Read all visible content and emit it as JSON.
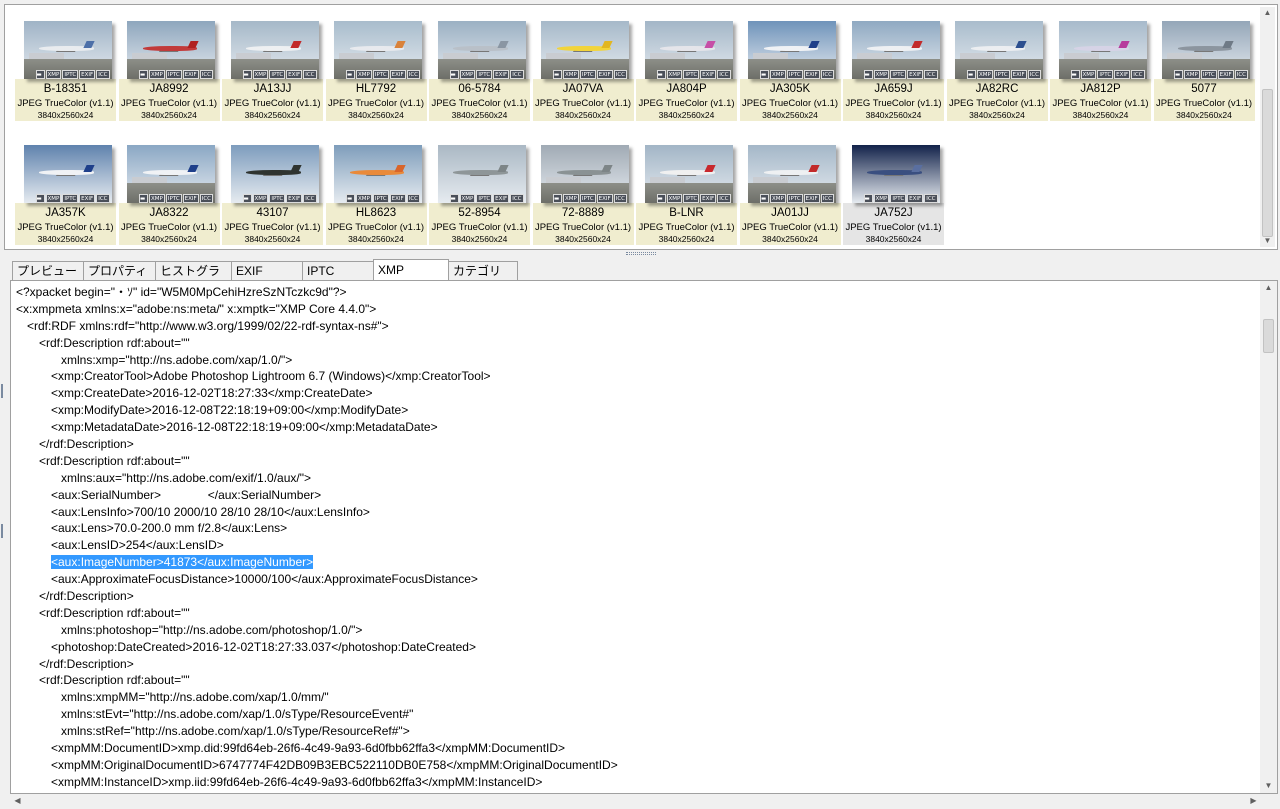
{
  "thumbnails": [
    {
      "name": "B-18351",
      "format": "JPEG TrueColor (v1.1)",
      "dims": "3840x2560x24",
      "sky": "#9fb3c6",
      "body": "#e9ecef",
      "tail": "#4c6fa8",
      "ground": true,
      "selected": false
    },
    {
      "name": "JA8992",
      "format": "JPEG TrueColor (v1.1)",
      "dims": "3840x2560x24",
      "sky": "#8ea6bd",
      "body": "#c23a3a",
      "tail": "#b02020",
      "ground": true,
      "selected": false
    },
    {
      "name": "JA13JJ",
      "format": "JPEG TrueColor (v1.1)",
      "dims": "3840x2560x24",
      "sky": "#a5b8c8",
      "body": "#eef0f2",
      "tail": "#c22a2a",
      "ground": true,
      "selected": false
    },
    {
      "name": "HL7792",
      "format": "JPEG TrueColor (v1.1)",
      "dims": "3840x2560x24",
      "sky": "#a8bccc",
      "body": "#e8eaee",
      "tail": "#d9823a",
      "ground": true,
      "selected": false
    },
    {
      "name": "06-5784",
      "format": "JPEG TrueColor (v1.1)",
      "dims": "3840x2560x24",
      "sky": "#9bb0c3",
      "body": "#b9c0c8",
      "tail": "#8a96a3",
      "ground": true,
      "selected": false
    },
    {
      "name": "JA07VA",
      "format": "JPEG TrueColor (v1.1)",
      "dims": "3840x2560x24",
      "sky": "#a6b9c9",
      "body": "#f2d43a",
      "tail": "#e2b620",
      "ground": true,
      "selected": false
    },
    {
      "name": "JA804P",
      "format": "JPEG TrueColor (v1.1)",
      "dims": "3840x2560x24",
      "sky": "#a3b6c7",
      "body": "#e5e5ea",
      "tail": "#c64fa6",
      "ground": true,
      "selected": false
    },
    {
      "name": "JA305K",
      "format": "JPEG TrueColor (v1.1)",
      "dims": "3840x2560x24",
      "sky": "#6f93ba",
      "body": "#f0f2f5",
      "tail": "#1e3f8a",
      "ground": true,
      "selected": false
    },
    {
      "name": "JA659J",
      "format": "JPEG TrueColor (v1.1)",
      "dims": "3840x2560x24",
      "sky": "#8fa9c2",
      "body": "#eef0f3",
      "tail": "#c22a2a",
      "ground": true,
      "selected": false
    },
    {
      "name": "JA82RC",
      "format": "JPEG TrueColor (v1.1)",
      "dims": "3840x2560x24",
      "sky": "#a9bccc",
      "body": "#eceef1",
      "tail": "#2c4f8f",
      "ground": true,
      "selected": false
    },
    {
      "name": "JA812P",
      "format": "JPEG TrueColor (v1.1)",
      "dims": "3840x2560x24",
      "sky": "#a7bacb",
      "body": "#d6d3e6",
      "tail": "#b73a9c",
      "ground": true,
      "selected": false
    },
    {
      "name": "5077",
      "format": "JPEG TrueColor (v1.1)",
      "dims": "3840x2560x24",
      "sky": "#94a6b8",
      "body": "#8c959f",
      "tail": "#6f7a86",
      "ground": true,
      "selected": false
    },
    {
      "name": "JA357K",
      "format": "JPEG TrueColor (v1.1)",
      "dims": "3840x2560x24",
      "sky": "#5f82ad",
      "body": "#f0f2f5",
      "tail": "#1e3f8a",
      "ground": false,
      "selected": false
    },
    {
      "name": "JA8322",
      "format": "JPEG TrueColor (v1.1)",
      "dims": "3840x2560x24",
      "sky": "#8aa7c4",
      "body": "#f0f2f5",
      "tail": "#1e3f8a",
      "ground": true,
      "selected": false
    },
    {
      "name": "43107",
      "format": "JPEG TrueColor (v1.1)",
      "dims": "3840x2560x24",
      "sky": "#7d9cbd",
      "body": "#2f3430",
      "tail": "#2f3430",
      "ground": false,
      "selected": false
    },
    {
      "name": "HL8623",
      "format": "JPEG TrueColor (v1.1)",
      "dims": "3840x2560x24",
      "sky": "#7e9dbb",
      "body": "#e98a3a",
      "tail": "#d9652a",
      "ground": false,
      "selected": false
    },
    {
      "name": "52-8954",
      "format": "JPEG TrueColor (v1.1)",
      "dims": "3840x2560x24",
      "sky": "#aab8c4",
      "body": "#8e9698",
      "tail": "#7d8587",
      "ground": false,
      "selected": false
    },
    {
      "name": "72-8889",
      "format": "JPEG TrueColor (v1.1)",
      "dims": "3840x2560x24",
      "sky": "#a0aab4",
      "body": "#8a9294",
      "tail": "#7d8587",
      "ground": true,
      "selected": false
    },
    {
      "name": "B-LNR",
      "format": "JPEG TrueColor (v1.1)",
      "dims": "3840x2560x24",
      "sky": "#a2b5c6",
      "body": "#f0f0f0",
      "tail": "#c8282d",
      "ground": true,
      "selected": false
    },
    {
      "name": "JA01JJ",
      "format": "JPEG TrueColor (v1.1)",
      "dims": "3840x2560x24",
      "sky": "#a4b7c8",
      "body": "#eef0f2",
      "tail": "#c22a2a",
      "ground": true,
      "selected": false
    },
    {
      "name": "JA752J",
      "format": "JPEG TrueColor (v1.1)",
      "dims": "3840x2560x24",
      "sky": "#12224a",
      "body": "#3a4f80",
      "tail": "#5a6fa0",
      "ground": false,
      "selected": true
    }
  ],
  "badge_labels": [
    "XMP",
    "IPTC",
    "EXIF",
    "ICC"
  ],
  "tabs": [
    {
      "label": "プレビュー",
      "active": false
    },
    {
      "label": "プロパティ",
      "active": false
    },
    {
      "label": "ヒストグラム",
      "active": false
    },
    {
      "label": "EXIF",
      "active": false
    },
    {
      "label": "IPTC",
      "active": false
    },
    {
      "label": "XMP",
      "active": true
    },
    {
      "label": "カテゴリ",
      "active": false
    }
  ],
  "xmp_lines": [
    {
      "indent": 0,
      "text": "<?xpacket begin=\"・ｿ\" id=\"W5M0MpCehiHzreSzNTczkc9d\"?>",
      "highlight": false
    },
    {
      "indent": 0,
      "text": "<x:xmpmeta xmlns:x=\"adobe:ns:meta/\" x:xmptk=\"XMP Core 4.4.0\">",
      "highlight": false
    },
    {
      "indent": 1,
      "text": "<rdf:RDF xmlns:rdf=\"http://www.w3.org/1999/02/22-rdf-syntax-ns#\">",
      "highlight": false
    },
    {
      "indent": 2,
      "text": "<rdf:Description rdf:about=\"\"",
      "highlight": false
    },
    {
      "indent": 4,
      "text": "xmlns:xmp=\"http://ns.adobe.com/xap/1.0/\">",
      "highlight": false
    },
    {
      "indent": 3,
      "text": "<xmp:CreatorTool>Adobe Photoshop Lightroom 6.7 (Windows)</xmp:CreatorTool>",
      "highlight": false
    },
    {
      "indent": 3,
      "text": "<xmp:CreateDate>2016-12-02T18:27:33</xmp:CreateDate>",
      "highlight": false
    },
    {
      "indent": 3,
      "text": "<xmp:ModifyDate>2016-12-08T22:18:19+09:00</xmp:ModifyDate>",
      "highlight": false
    },
    {
      "indent": 3,
      "text": "<xmp:MetadataDate>2016-12-08T22:18:19+09:00</xmp:MetadataDate>",
      "highlight": false
    },
    {
      "indent": 2,
      "text": "</rdf:Description>",
      "highlight": false
    },
    {
      "indent": 2,
      "text": "<rdf:Description rdf:about=\"\"",
      "highlight": false
    },
    {
      "indent": 4,
      "text": "xmlns:aux=\"http://ns.adobe.com/exif/1.0/aux/\">",
      "highlight": false
    },
    {
      "indent": 3,
      "text": "<aux:SerialNumber>              </aux:SerialNumber>",
      "highlight": false
    },
    {
      "indent": 3,
      "text": "<aux:LensInfo>700/10 2000/10 28/10 28/10</aux:LensInfo>",
      "highlight": false
    },
    {
      "indent": 3,
      "text": "<aux:Lens>70.0-200.0 mm f/2.8</aux:Lens>",
      "highlight": false
    },
    {
      "indent": 3,
      "text": "<aux:LensID>254</aux:LensID>",
      "highlight": false
    },
    {
      "indent": 3,
      "text": "<aux:ImageNumber>41873</aux:ImageNumber>",
      "highlight": true
    },
    {
      "indent": 3,
      "text": "<aux:ApproximateFocusDistance>10000/100</aux:ApproximateFocusDistance>",
      "highlight": false
    },
    {
      "indent": 2,
      "text": "</rdf:Description>",
      "highlight": false
    },
    {
      "indent": 2,
      "text": "<rdf:Description rdf:about=\"\"",
      "highlight": false
    },
    {
      "indent": 4,
      "text": "xmlns:photoshop=\"http://ns.adobe.com/photoshop/1.0/\">",
      "highlight": false
    },
    {
      "indent": 3,
      "text": "<photoshop:DateCreated>2016-12-02T18:27:33.037</photoshop:DateCreated>",
      "highlight": false
    },
    {
      "indent": 2,
      "text": "</rdf:Description>",
      "highlight": false
    },
    {
      "indent": 2,
      "text": "<rdf:Description rdf:about=\"\"",
      "highlight": false
    },
    {
      "indent": 4,
      "text": "xmlns:xmpMM=\"http://ns.adobe.com/xap/1.0/mm/\"",
      "highlight": false
    },
    {
      "indent": 4,
      "text": "xmlns:stEvt=\"http://ns.adobe.com/xap/1.0/sType/ResourceEvent#\"",
      "highlight": false
    },
    {
      "indent": 4,
      "text": "xmlns:stRef=\"http://ns.adobe.com/xap/1.0/sType/ResourceRef#\">",
      "highlight": false
    },
    {
      "indent": 3,
      "text": "<xmpMM:DocumentID>xmp.did:99fd64eb-26f6-4c49-9a93-6d0fbb62ffa3</xmpMM:DocumentID>",
      "highlight": false
    },
    {
      "indent": 3,
      "text": "<xmpMM:OriginalDocumentID>6747774F42DB09B3EBC522110DB0E758</xmpMM:OriginalDocumentID>",
      "highlight": false
    },
    {
      "indent": 3,
      "text": "<xmpMM:InstanceID>xmp.iid:99fd64eb-26f6-4c49-9a93-6d0fbb62ffa3</xmpMM:InstanceID>",
      "highlight": false
    }
  ]
}
